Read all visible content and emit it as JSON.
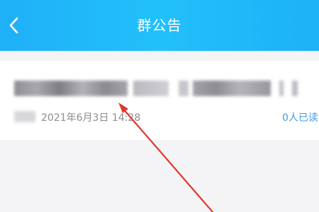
{
  "header": {
    "title": "群公告",
    "back_icon": "chevron-left-icon",
    "background": "#1fb8f9"
  },
  "announcement": {
    "post_time": "2021年6月3日 14:28",
    "read_status": "0人已读",
    "read_status_color": "#3d9be9",
    "content_obscured": true,
    "author_obscured": true
  },
  "annotation": {
    "arrow_color": "#e0392b",
    "arrow_icon": "red-arrow-annotation"
  }
}
